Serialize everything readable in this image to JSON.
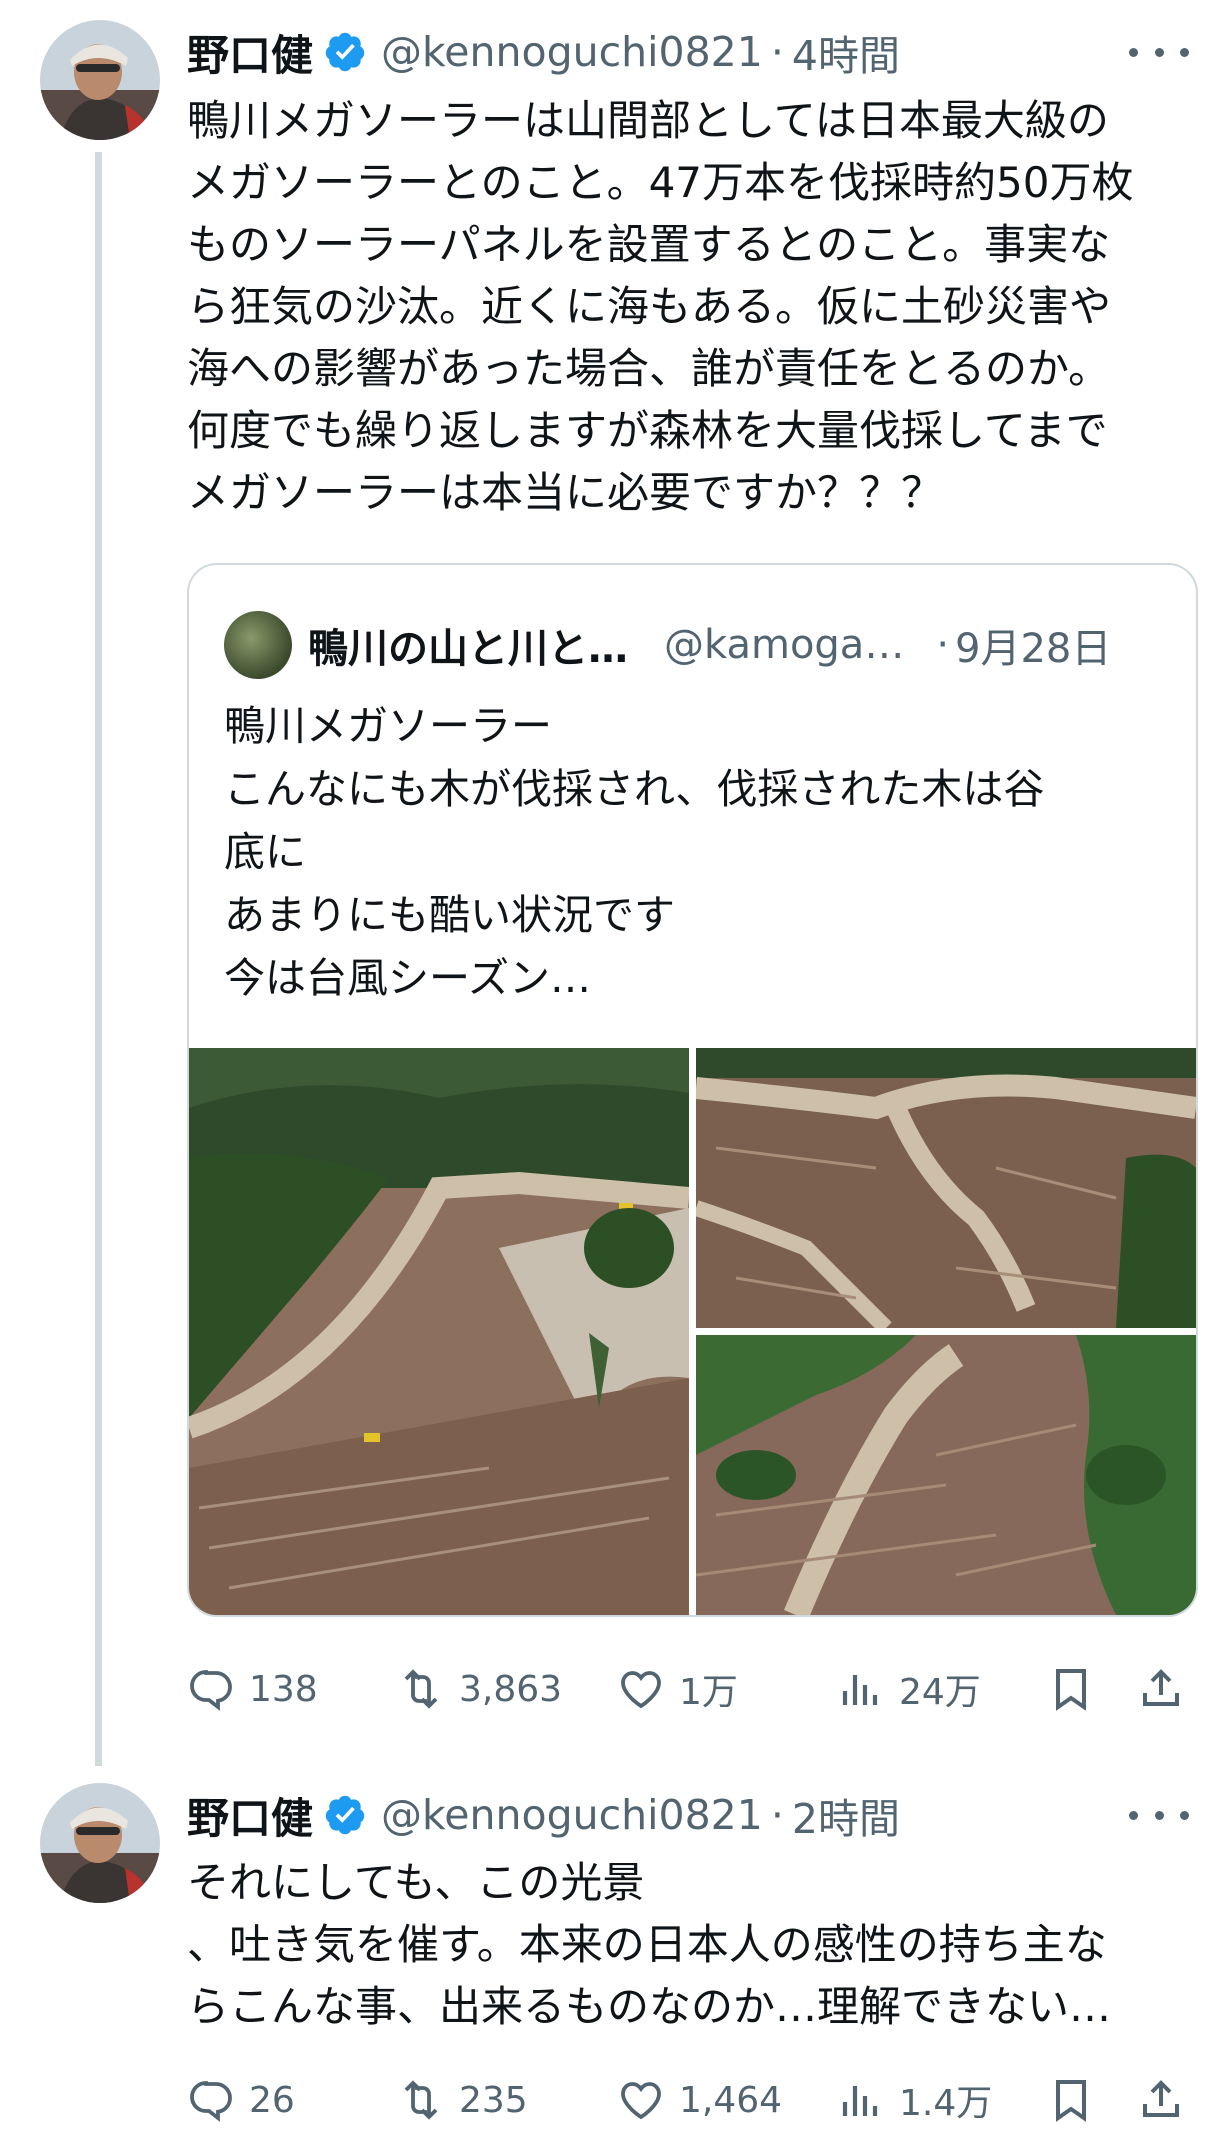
{
  "tweets": [
    {
      "name": "野口健",
      "handle": "@kennoguchi0821",
      "separator": "·",
      "time": "4時間",
      "text": "鴨川メガソーラーは山間部としては日本最大級の\nメガソーラーとのこと。47万本を伐採時約50万枚\nものソーラーパネルを設置するとのこと。事実な\nら狂気の沙汰。近くに海もある。仮に土砂災害や\n海への影響があった場合、誰が責任をとるのか。\n何度でも繰り返しますが森林を大量伐採してまで\nメガソーラーは本当に必要ですか？？？",
      "stats": {
        "replies": "138",
        "reposts": "3,863",
        "likes": "1万",
        "views": "24万"
      }
    },
    {
      "name": "野口健",
      "handle": "@kennoguchi0821",
      "separator": "·",
      "time": "2時間",
      "text": "それにしても、この光景\n、吐き気を催す。本来の日本人の感性の持ち主な\nらこんな事、出来るものなのか…理解できない…",
      "stats": {
        "replies": "26",
        "reposts": "235",
        "likes": "1,464",
        "views": "1.4万"
      }
    }
  ],
  "quote": {
    "name": "鴨川の山と川と…",
    "handle": "@kamoga…",
    "separator": "·",
    "time": "9月28日",
    "text": "鴨川メガソーラー\nこんなにも木が伐採され、伐採された木は谷\n底に\nあまりにも酷い状況です\n今は台風シーズン…",
    "images": [
      "logged-hillside-aerial",
      "clearcut-slope-road",
      "felled-trees-ridge"
    ]
  },
  "colors": {
    "verified": "#1d9bf0",
    "secondary_text": "#536471",
    "border": "#cfd9de"
  }
}
